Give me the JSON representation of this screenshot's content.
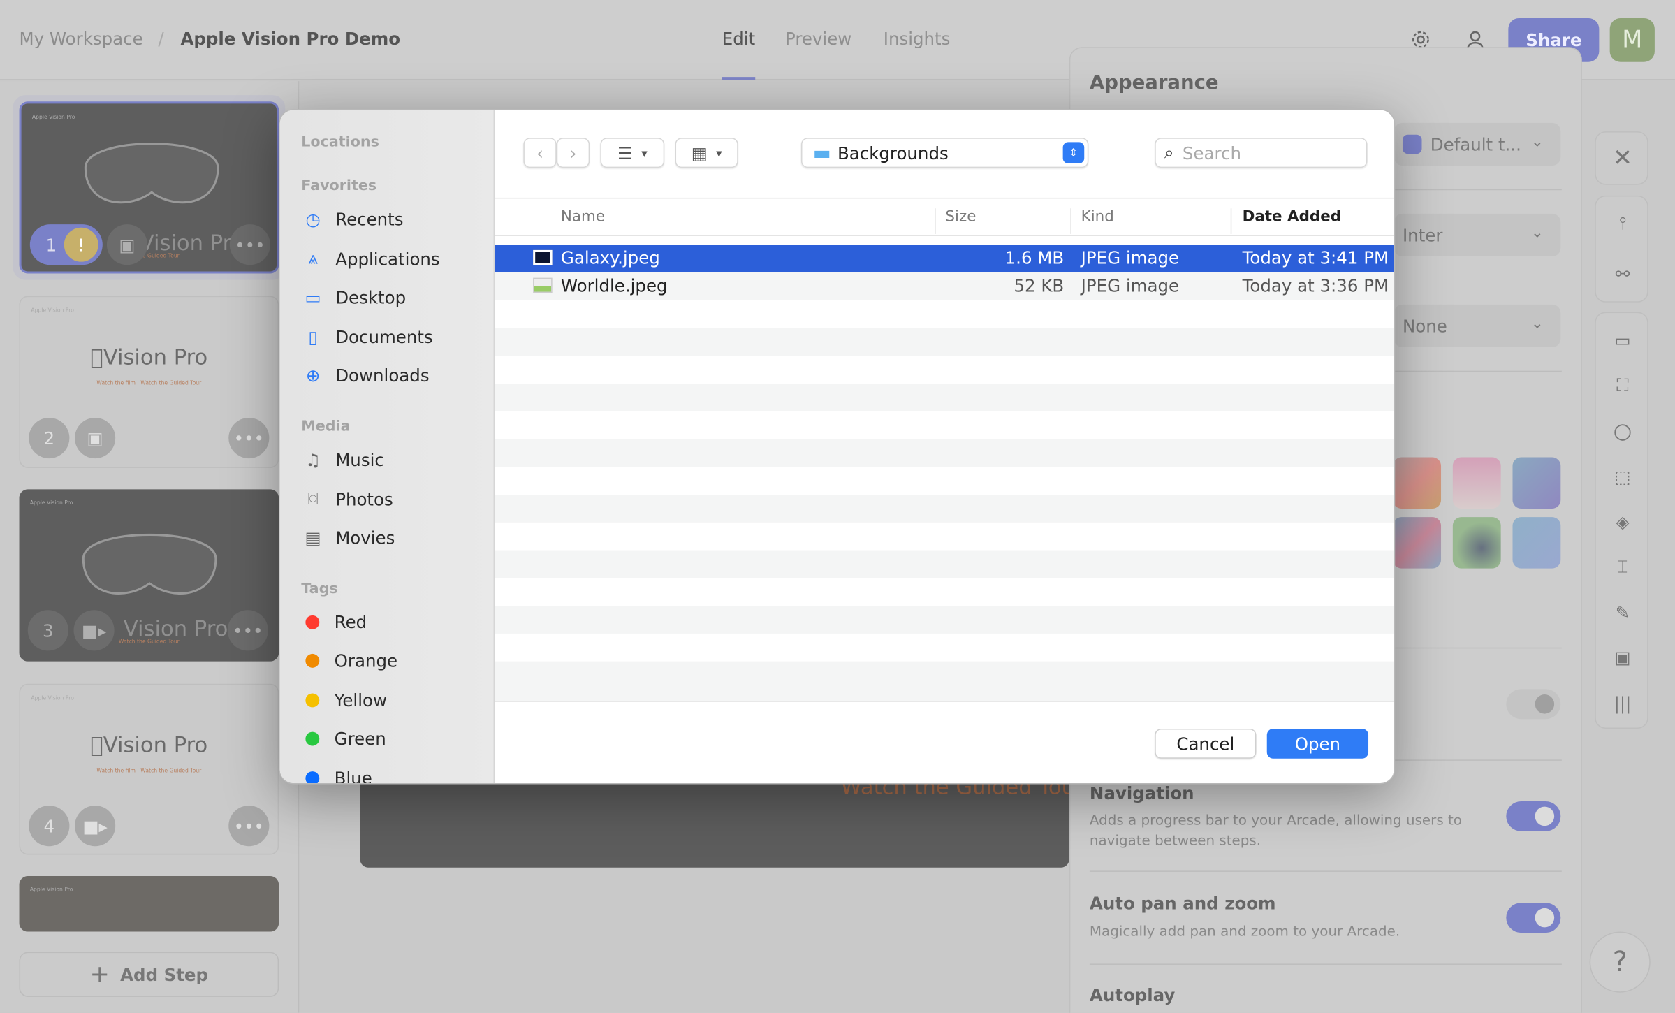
{
  "header": {
    "breadcrumb": [
      "My Workspace",
      "Apple Vision Pro Demo"
    ],
    "tabs": [
      "Edit",
      "Preview",
      "Insights"
    ],
    "active_tab": "Edit",
    "share_label": "Share",
    "avatar_initial": "M"
  },
  "steps": [
    {
      "number": "1",
      "title": "Vision Pro",
      "subtitle": "Watch the Guided Tour",
      "header": "Apple Vision Pro",
      "media": "image-icon",
      "warning": "!"
    },
    {
      "number": "2",
      "title": "Vision Pro",
      "subtitle": "Watch the film · Watch the Guided Tour",
      "header": "Apple Vision Pro",
      "media": "image-icon"
    },
    {
      "number": "3",
      "title": "Vision Pro",
      "subtitle": "Watch the Guided Tour",
      "header": "Apple Vision Pro",
      "media": "video-icon"
    },
    {
      "number": "4",
      "title": "Vision Pro",
      "subtitle": "Watch the film · Watch the Guided Tour",
      "header": "Apple Vision Pro",
      "media": "video-icon"
    },
    {
      "header": "Apple Vision Pro"
    }
  ],
  "add_step_label": "Add Step",
  "canvas": {
    "caption": "Watch the Guided Tou"
  },
  "panel": {
    "title": "Appearance",
    "theme_value": "Default t...",
    "font_value": "Inter",
    "third_value": "None",
    "settings": [
      {
        "title": "Navigation",
        "desc": "Adds a progress bar to your Arcade, allowing users to navigate between steps.",
        "enabled": true
      },
      {
        "title": "Auto pan and zoom",
        "desc": "Magically add pan and zoom to your Arcade.",
        "enabled": true
      },
      {
        "title": "Autoplay"
      }
    ]
  },
  "help_label": "?",
  "dialog": {
    "sidebar": {
      "locations": "Locations",
      "favorites_label": "Favorites",
      "favorites": [
        "Recents",
        "Applications",
        "Desktop",
        "Documents",
        "Downloads"
      ],
      "media_label": "Media",
      "media": [
        "Music",
        "Photos",
        "Movies"
      ],
      "tags_label": "Tags",
      "tags": [
        {
          "name": "Red",
          "color": "#ff3b30"
        },
        {
          "name": "Orange",
          "color": "#f08a00"
        },
        {
          "name": "Yellow",
          "color": "#f5c000"
        },
        {
          "name": "Green",
          "color": "#28c840"
        },
        {
          "name": "Blue",
          "color": "#0a6cff"
        }
      ]
    },
    "location": "Backgrounds",
    "search_placeholder": "Search",
    "columns": [
      "Name",
      "Size",
      "Kind",
      "Date Added"
    ],
    "files": [
      {
        "name": "Galaxy.jpeg",
        "size": "1.6 MB",
        "kind": "JPEG image",
        "date": "Today at 3:41 PM",
        "selected": true
      },
      {
        "name": "Worldle.jpeg",
        "size": "52 KB",
        "kind": "JPEG image",
        "date": "Today at 3:36 PM",
        "selected": false
      }
    ],
    "cancel_label": "Cancel",
    "open_label": "Open"
  },
  "colors": {
    "accent": "#7a81c8",
    "selection": "#2c5fd9",
    "open_button": "#2f7cf6"
  }
}
